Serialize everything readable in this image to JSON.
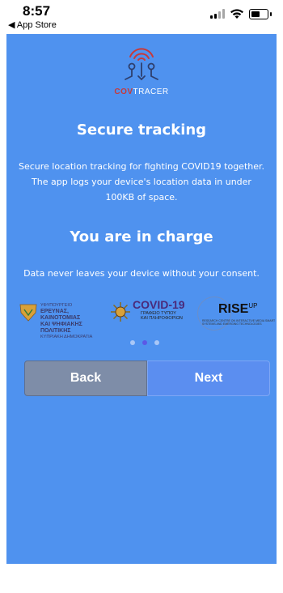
{
  "status_bar": {
    "time": "8:57",
    "back_label": "◀ App Store"
  },
  "brand": {
    "bold": "COV",
    "rest": "TRACER"
  },
  "sections": [
    {
      "title": "Secure tracking",
      "text": "Secure location tracking for fighting COVID19 together. The app logs your device's location data in under 100KB of space."
    },
    {
      "title": "You are in charge",
      "text": "Data never leaves your device without your consent."
    }
  ],
  "partner_logos": {
    "gov_line1": "ΥΦΥΠΟΥΡΓΕΙΟ",
    "gov_line2": "ΕΡΕΥΝΑΣ, ΚΑΙΝΟΤΟΜΙΑΣ",
    "gov_line3": "ΚΑΙ ΨΗΦΙΑΚΗΣ ΠΟΛΙΤΙΚΗΣ",
    "gov_line4": "ΚΥΠΡΙΑΚΗ ΔΗΜΟΚΡΑΤΙΑ",
    "covid_title": "COVID-19",
    "covid_sub1": "ΓΡΑΦΕΙΟ ΤΥΠΟΥ",
    "covid_sub2": "ΚΑΙ ΠΛΗΡΟΦΟΡΙΩΝ",
    "rise_main": "RISE",
    "rise_up": "UP",
    "rise_sub": "RESEARCH CENTRE ON INTERACTIVE MEDIA SMART SYSTEMS AND EMERGING TECHNOLOGIES"
  },
  "pager": {
    "pages": 3,
    "current": 2
  },
  "buttons": {
    "back": "Back",
    "next": "Next"
  },
  "colors": {
    "background": "#4f92ef",
    "back_button": "#7e8da8",
    "next_button": "#5b8ef0",
    "logo_red": "#c73a3a",
    "active_dot": "#5b59e6"
  }
}
